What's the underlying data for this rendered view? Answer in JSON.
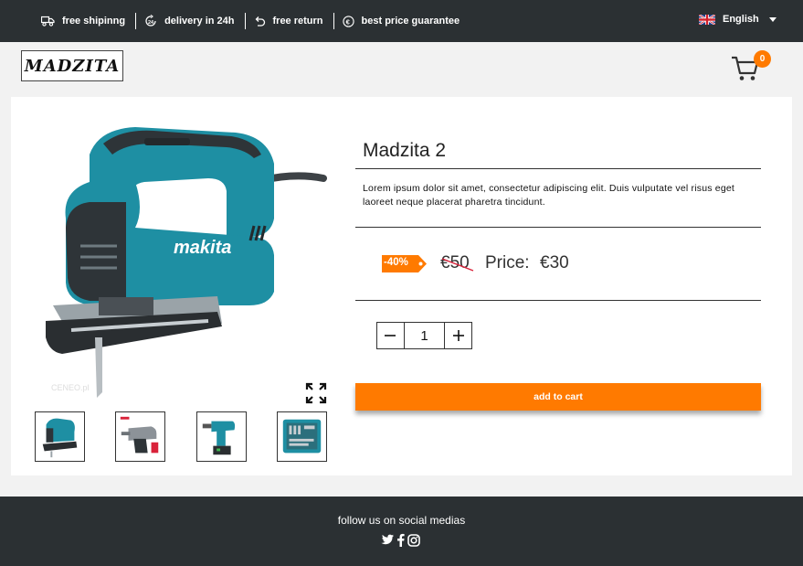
{
  "topbar": {
    "perks": [
      {
        "label": "free shipinng",
        "icon": "truck-icon"
      },
      {
        "label": "delivery in 24h",
        "icon": "clock-24-icon"
      },
      {
        "label": "free return",
        "icon": "return-arrow-icon"
      },
      {
        "label": "best price guarantee",
        "icon": "euro-icon"
      }
    ],
    "language": "English"
  },
  "header": {
    "logo_text": "MADZITA",
    "cart_count": "0"
  },
  "product": {
    "title": "Madzita 2",
    "description": "Lorem ipsum dolor sit amet, consectetur adipiscing elit. Duis vulputate vel risus eget laoreet neque placerat pharetra tincidunt.",
    "discount": "-40%",
    "old_price": "€50",
    "price_label": "Price:",
    "price": "€30",
    "quantity": "1",
    "add_to_cart": "add to cart",
    "thumbnails": [
      "jigsaw",
      "hammer drill",
      "cordless drill",
      "tool kit case"
    ]
  },
  "footer": {
    "follow_text": "follow us on social medias",
    "socials": [
      "twitter-icon",
      "facebook-icon",
      "instagram-icon"
    ]
  },
  "colors": {
    "bar": "#2b3033",
    "accent": "#ff7a00",
    "tool_teal": "#1e8fa3"
  }
}
